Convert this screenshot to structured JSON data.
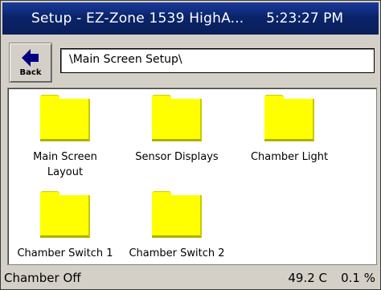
{
  "window": {
    "title": "Setup - EZ-Zone 1539 HighA...",
    "time": "5:23:27 PM"
  },
  "toolbar": {
    "back_label": "Back",
    "path": "\\Main Screen Setup\\"
  },
  "folders": [
    {
      "label": "Main Screen Layout"
    },
    {
      "label": "Sensor Displays"
    },
    {
      "label": "Chamber Light"
    },
    {
      "label": "Chamber Switch 1"
    },
    {
      "label": "Chamber Switch 2"
    }
  ],
  "status": {
    "mode": "Chamber Off",
    "temperature": "49.2 C",
    "humidity": "0.1 %"
  },
  "colors": {
    "titlebar": "#0a246a",
    "folder": "#ffff00",
    "chrome": "#d4d0c8"
  }
}
